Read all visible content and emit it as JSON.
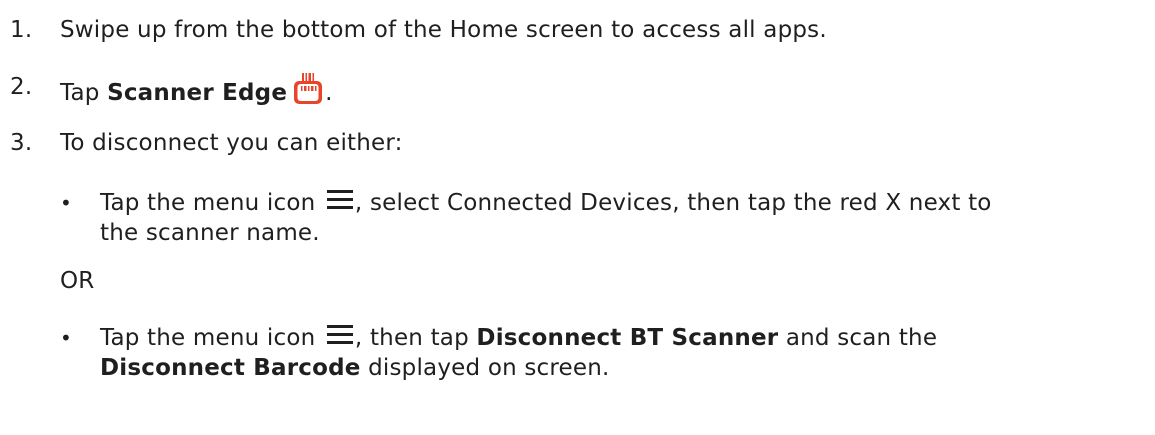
{
  "steps": [
    {
      "number": "1.",
      "text": "Swipe up from the bottom of the Home screen to access all apps."
    },
    {
      "number": "2.",
      "prefix": "Tap ",
      "app_name": "Scanner Edge",
      "suffix": ".",
      "icon": "scanner-edge-app-icon"
    },
    {
      "number": "3.",
      "text": "To disconnect you can either:"
    }
  ],
  "options": {
    "first": {
      "prefix": "Tap the menu icon ",
      "suffix_line1": ", select Connected Devices, then tap the red X next to",
      "line2": "the scanner name.",
      "icon": "hamburger-menu-icon"
    },
    "separator": "OR",
    "second": {
      "prefix": "Tap the menu icon ",
      "middle": ", then tap ",
      "bold1": "Disconnect BT Scanner",
      "after_bold1": " and scan the",
      "bold2": "Disconnect Barcode",
      "after_bold2": " displayed on screen.",
      "icon": "hamburger-menu-icon"
    }
  },
  "colors": {
    "text": "#1f1f1f",
    "icon_accent": "#e8442a"
  }
}
